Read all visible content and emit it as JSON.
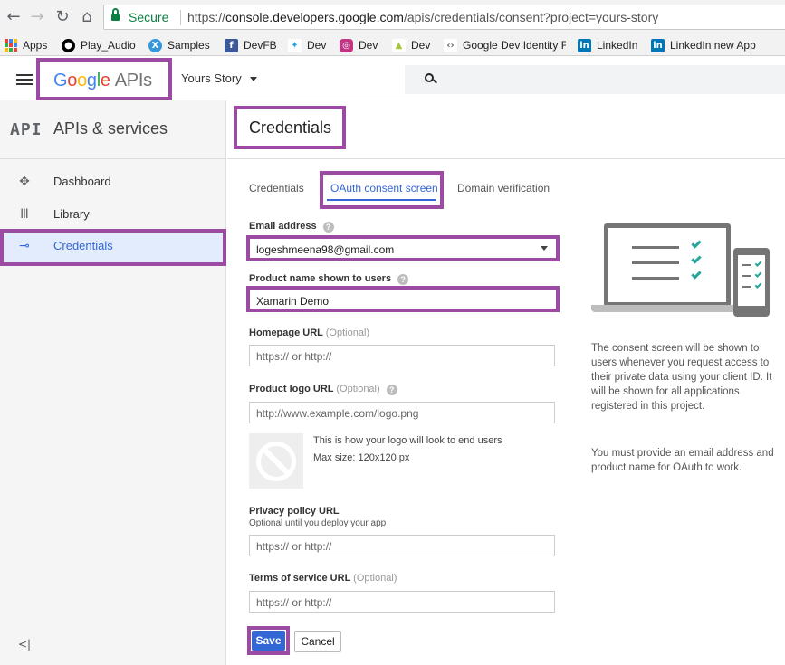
{
  "browser": {
    "secure_label": "Secure",
    "url_scheme": "https://",
    "url_host": "console.developers.google.com",
    "url_path": "/apis/credentials/consent?project=yours-story",
    "bookmarks": [
      {
        "label": "Apps",
        "icon": "apps-grid-icon"
      },
      {
        "label": "Play_Audio",
        "icon": "github-icon",
        "color": "#000000"
      },
      {
        "label": "Samples",
        "icon": "xamarin-icon",
        "color": "#3498db"
      },
      {
        "label": "DevFB",
        "icon": "facebook-icon",
        "color": "#3b5998"
      },
      {
        "label": "Dev",
        "icon": "twitter-icon",
        "color": "#1da1f2"
      },
      {
        "label": "Dev",
        "icon": "instagram-icon",
        "color": "#c13584"
      },
      {
        "label": "Dev",
        "icon": "android-icon",
        "color": "#a4c639"
      },
      {
        "label": "Google Dev Identity F",
        "icon": "google-dev-icon"
      },
      {
        "label": "LinkedIn",
        "icon": "linkedin-icon",
        "color": "#0077b5"
      },
      {
        "label": "LinkedIn new App",
        "icon": "linkedin-icon",
        "color": "#0077b5"
      }
    ]
  },
  "header": {
    "logo_google": "Google",
    "logo_apis": "APIs",
    "project_name": "Yours Story"
  },
  "sidebar": {
    "badge": "API",
    "title": "APIs & services",
    "items": [
      {
        "label": "Dashboard",
        "icon": "dashboard-icon"
      },
      {
        "label": "Library",
        "icon": "library-icon"
      },
      {
        "label": "Credentials",
        "icon": "key-icon",
        "active": true
      }
    ],
    "collapse_label": "<|"
  },
  "main": {
    "title": "Credentials",
    "tabs": [
      {
        "label": "Credentials"
      },
      {
        "label": "OAuth consent screen",
        "active": true
      },
      {
        "label": "Domain verification"
      }
    ],
    "form": {
      "email_label": "Email address",
      "email_value": "logeshmeena98@gmail.com",
      "product_label": "Product name shown to users",
      "product_value": "Xamarin Demo",
      "homepage_label": "Homepage URL",
      "homepage_optional": "(Optional)",
      "homepage_placeholder": "https:// or http://",
      "logo_label": "Product logo URL",
      "logo_optional": "(Optional)",
      "logo_placeholder": "http://www.example.com/logo.png",
      "logo_note": "This is how your logo will look to end users",
      "logo_size": "Max size: 120x120 px",
      "privacy_label": "Privacy policy URL",
      "privacy_sublabel": "Optional until you deploy your app",
      "privacy_placeholder": "https:// or http://",
      "terms_label": "Terms of service URL",
      "terms_optional": "(Optional)",
      "terms_placeholder": "https:// or http://",
      "save_label": "Save",
      "cancel_label": "Cancel"
    },
    "info": {
      "para1": "The consent screen will be shown to users whenever you request access to their private data using your client ID. It will be shown for all applications registered in this project.",
      "para2": "You must provide an email address and product name for OAuth to work."
    }
  },
  "colors": {
    "highlight": "#9c4ba3",
    "accent": "#3367d6",
    "secure": "#0b8043"
  }
}
